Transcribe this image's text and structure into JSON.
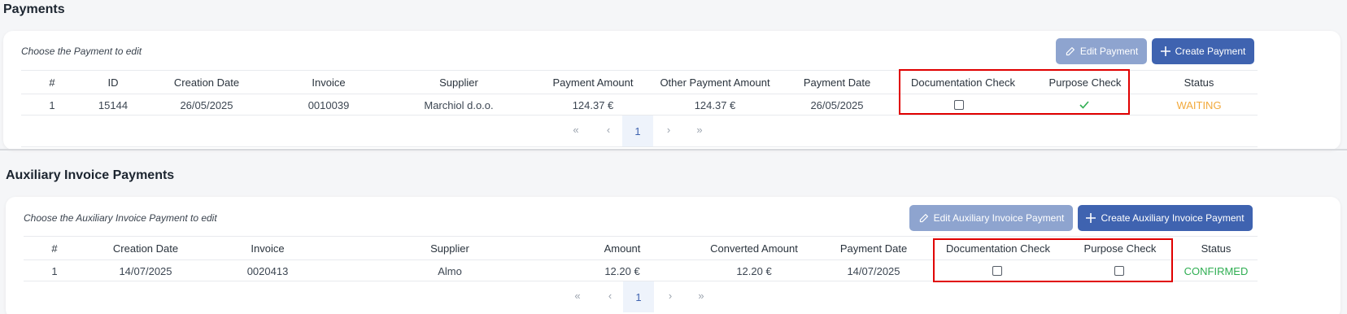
{
  "payments": {
    "title": "Payments",
    "choose_text": "Choose the Payment to edit",
    "edit_label": "Edit Payment",
    "create_label": "Create Payment",
    "columns": [
      "#",
      "ID",
      "Creation Date",
      "Invoice",
      "Supplier",
      "Payment Amount",
      "Other Payment Amount",
      "Payment Date",
      "Documentation Check",
      "Purpose Check",
      "Status"
    ],
    "rows": [
      {
        "num": "1",
        "id": "15144",
        "creation_date": "26/05/2025",
        "invoice": "0010039",
        "supplier": "Marchiol d.o.o.",
        "payment_amount": "124.37 €",
        "other_payment_amount": "124.37 €",
        "payment_date": "26/05/2025",
        "documentation_check": false,
        "purpose_check": true,
        "status": "WAITING"
      }
    ],
    "pager": {
      "first": "«",
      "prev": "‹",
      "page": "1",
      "next": "›",
      "last": "»"
    }
  },
  "aux": {
    "title": "Auxiliary Invoice Payments",
    "choose_text": "Choose the Auxiliary Invoice Payment to edit",
    "edit_label": "Edit Auxiliary Invoice Payment",
    "create_label": "Create Auxiliary Invoice Payment",
    "columns": [
      "#",
      "Creation Date",
      "Invoice",
      "Supplier",
      "Amount",
      "Converted Amount",
      "Payment Date",
      "Documentation Check",
      "Purpose Check",
      "Status"
    ],
    "rows": [
      {
        "num": "1",
        "creation_date": "14/07/2025",
        "invoice": "0020413",
        "supplier": "Almo",
        "amount": "12.20 €",
        "converted_amount": "12.20 €",
        "payment_date": "14/07/2025",
        "documentation_check": false,
        "purpose_check": false,
        "status": "CONFIRMED"
      }
    ],
    "pager": {
      "first": "«",
      "prev": "‹",
      "page": "1",
      "next": "›",
      "last": "»"
    }
  },
  "colors": {
    "accent": "#3f63b0",
    "waiting": "#f2a93b",
    "confirmed": "#2fae52",
    "highlight": "#e00000"
  }
}
